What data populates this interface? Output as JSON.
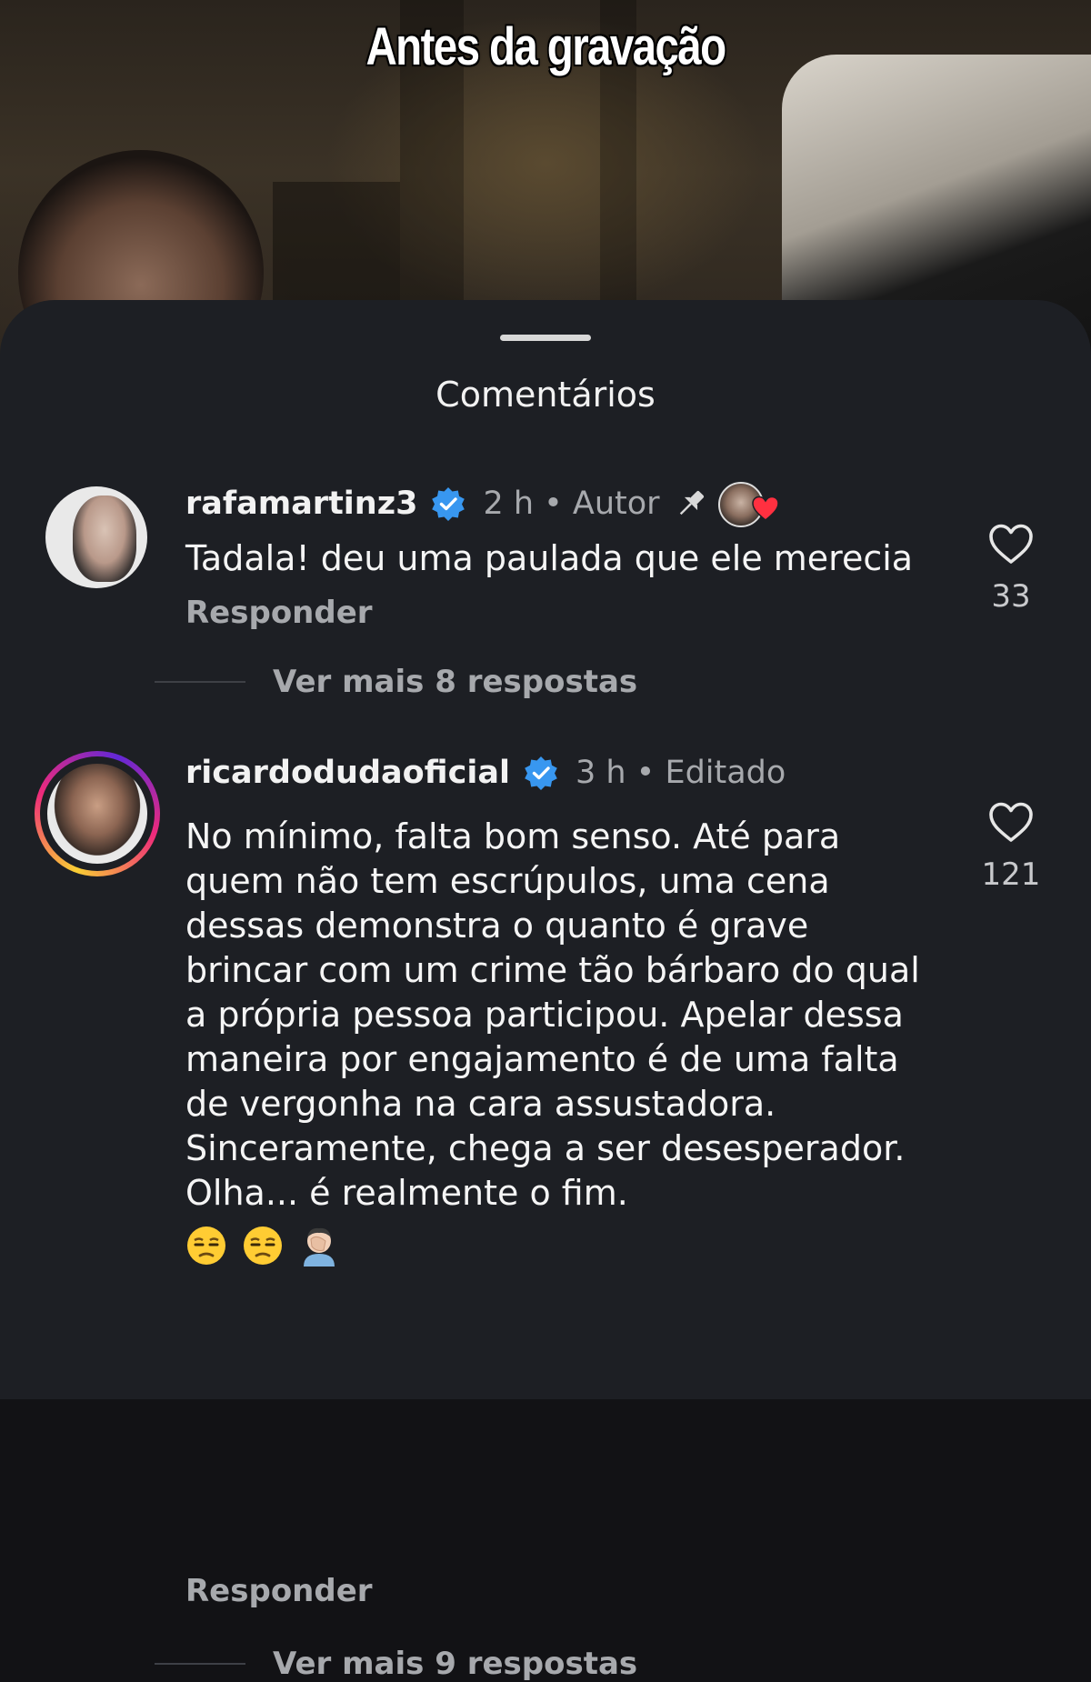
{
  "video": {
    "overlay_text": "Antes da gravação"
  },
  "sheet": {
    "title": "Comentários"
  },
  "comments": [
    {
      "username": "rafamartinz3",
      "meta": "2 h • Autor",
      "text": "Tadala! deu uma paulada que ele merecia",
      "reply_label": "Responder",
      "like_count": "33",
      "more_replies": "Ver mais 8 respostas",
      "pinned": true,
      "liked_by_author": true
    },
    {
      "username": "ricardodudaoficial",
      "meta": "3 h • Editado",
      "text": "No mínimo, falta bom senso. Até para quem não tem escrúpulos, uma cena dessas demonstra o quanto é grave brincar com um crime tão bárbaro do qual a própria pessoa participou. Apelar dessa maneira por engajamento é de uma falta de vergonha na cara assustadora. Sinceramente, chega a ser desesperador. Olha... é realmente o fim.",
      "emojis": [
        "unamused-face",
        "unamused-face",
        "person-facepalming"
      ],
      "reply_label": "Responder",
      "like_count": "121",
      "more_replies": "Ver mais 9 respostas",
      "has_story_ring": true
    }
  ],
  "colors": {
    "sheet_bg": "#1d1f24",
    "verified_blue": "#3897f0",
    "muted_text": "#a7a9ad",
    "heart_red": "#ff3040"
  }
}
